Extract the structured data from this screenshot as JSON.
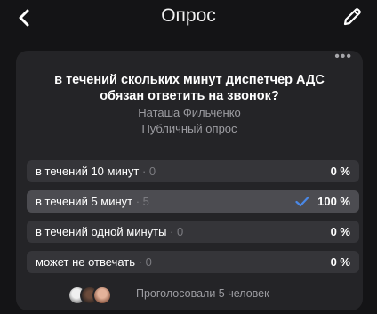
{
  "header": {
    "title": "Опрос",
    "back_icon": "chevron-left-icon",
    "edit_icon": "pencil-icon"
  },
  "poll": {
    "more_icon": "more-horizontal-icon",
    "question": "в течений скольких минут диспетчер АДС обязан ответить на звонок?",
    "author": "Наташа Фильченко",
    "type": "Публичный опрос",
    "options": [
      {
        "label": "в течений 10 минут",
        "count": " · 0",
        "percent": "0 %",
        "share": 0.0,
        "selected": false
      },
      {
        "label": "в течений 5 минут",
        "count": " · 5",
        "percent": "100 %",
        "share": 1.0,
        "selected": true
      },
      {
        "label": "в течений одной минуты",
        "count": " · 0",
        "percent": "0 %",
        "share": 0.0,
        "selected": false
      },
      {
        "label": "может не отвечать",
        "count": " · 0",
        "percent": "0 %",
        "share": 0.0,
        "selected": false
      }
    ],
    "footer": {
      "voters_text": "Проголосовали 5 человек"
    }
  },
  "colors": {
    "background": "#141416",
    "card": "#242427",
    "option": "#353539",
    "check": "#4a88e6"
  }
}
